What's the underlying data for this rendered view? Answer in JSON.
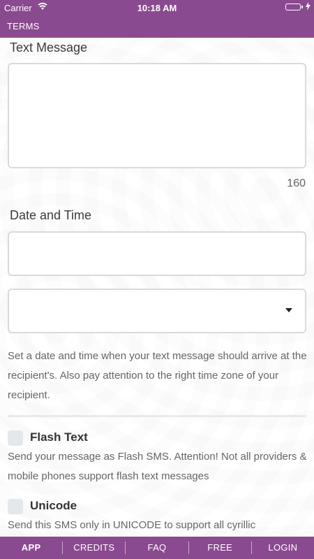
{
  "status_bar": {
    "carrier": "Carrier",
    "time": "10:18 AM",
    "battery_color": "#3ddb5a"
  },
  "header": {
    "title": "TERMS",
    "background": "#8a4a8f"
  },
  "form": {
    "text_message_label": "Text Message",
    "text_message_value": "",
    "char_counter": "160",
    "date_time_label": "Date and Time",
    "date_value": "",
    "timezone_value": "",
    "date_help": "Set a date and time when your text message should arrive at the recipient's. Also pay attention to the right time zone of your recipient.",
    "options": [
      {
        "label": "Flash Text",
        "description": "Send your message as Flash SMS. Attention! Not all providers & mobile phones support flash text messages"
      },
      {
        "label": "Unicode",
        "description": "Send this SMS only in UNICODE to support all cyrillic"
      }
    ]
  },
  "tabbar": {
    "tabs": [
      {
        "label": "APP"
      },
      {
        "label": "CREDITS"
      },
      {
        "label": "FAQ"
      },
      {
        "label": "FREE"
      },
      {
        "label": "LOGIN"
      }
    ],
    "active": "APP"
  },
  "icons": {
    "wifi": "wifi-icon",
    "battery": "battery-icon",
    "charging": "charging-bolt-icon",
    "dropdown": "chevron-down-icon"
  }
}
